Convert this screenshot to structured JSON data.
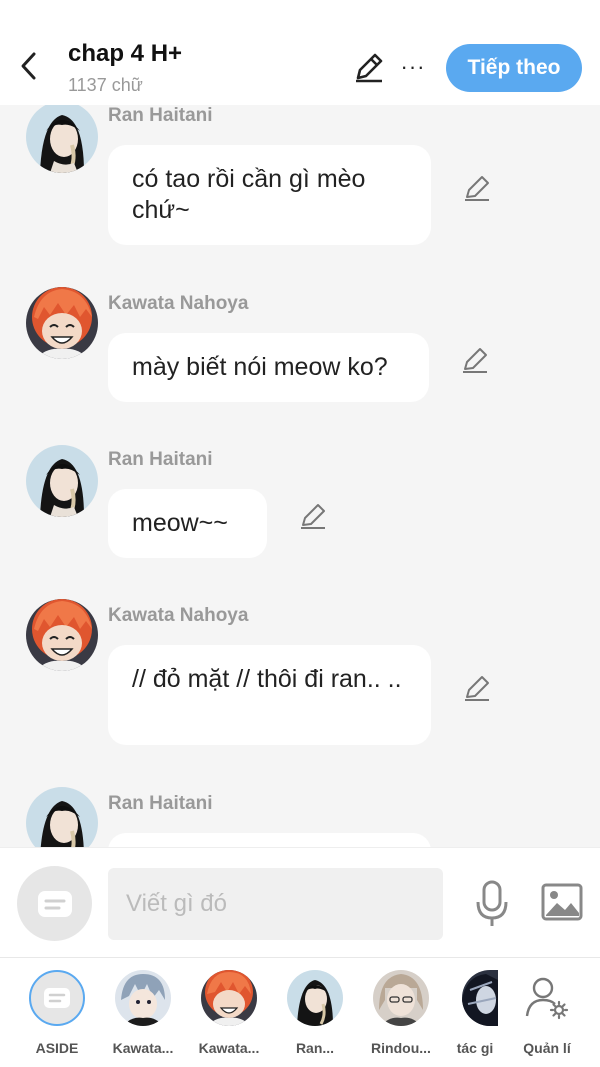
{
  "header": {
    "title": "chap 4 H+",
    "word_count": "1137 chữ",
    "next_label": "Tiếp theo",
    "more_label": "···"
  },
  "messages": [
    {
      "sender": "Ran Haitani",
      "text": "có tao rồi cần gì mèo chứ~"
    },
    {
      "sender": "Kawata Nahoya",
      "text": "mày biết nói meow ko?"
    },
    {
      "sender": "Ran Haitani",
      "text": "meow~~"
    },
    {
      "sender": "Kawata Nahoya",
      "text": "// đỏ mặt // thôi đi ran.. .."
    },
    {
      "sender": "Ran Haitani",
      "text": ""
    }
  ],
  "composer": {
    "placeholder": "Viết gì đó"
  },
  "characters": [
    {
      "label": "ASIDE"
    },
    {
      "label": "Kawata..."
    },
    {
      "label": "Kawata..."
    },
    {
      "label": "Ran..."
    },
    {
      "label": "Rindou..."
    },
    {
      "label": "tác gi"
    }
  ],
  "manage_label": "Quản lí",
  "colors": {
    "accent": "#5aa9f0",
    "background": "#f5f5f5",
    "bubble": "#ffffff"
  }
}
